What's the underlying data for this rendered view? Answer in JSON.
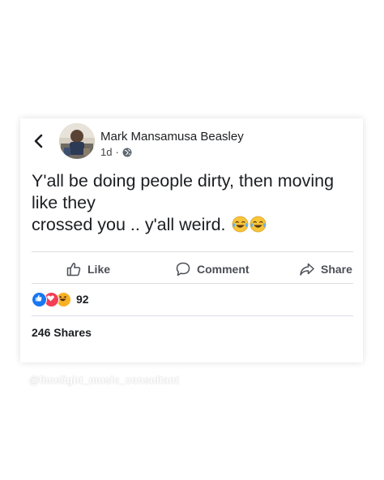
{
  "post": {
    "author": "Mark Mansamusa Beasley",
    "time": "1d",
    "separator": "·",
    "text_lines": [
      "Y'all be doing people dirty, then moving",
      "like they",
      "crossed you .. y'all weird."
    ],
    "emoji": [
      "tears-of-joy",
      "tears-of-joy"
    ]
  },
  "actions": {
    "like_label": "Like",
    "comment_label": "Comment",
    "share_label": "Share"
  },
  "reactions": {
    "icons": [
      "like-reaction",
      "love-reaction",
      "haha-reaction"
    ],
    "count": "92"
  },
  "shares_text": "246 Shares",
  "watermark": "@limelight_music_consultant",
  "colors": {
    "like_blue": "#1877f2",
    "love_red": "#f33e58",
    "haha_yellow": "#f7b125",
    "action_gray": "#4b4f56",
    "divider": "#dadde1"
  }
}
